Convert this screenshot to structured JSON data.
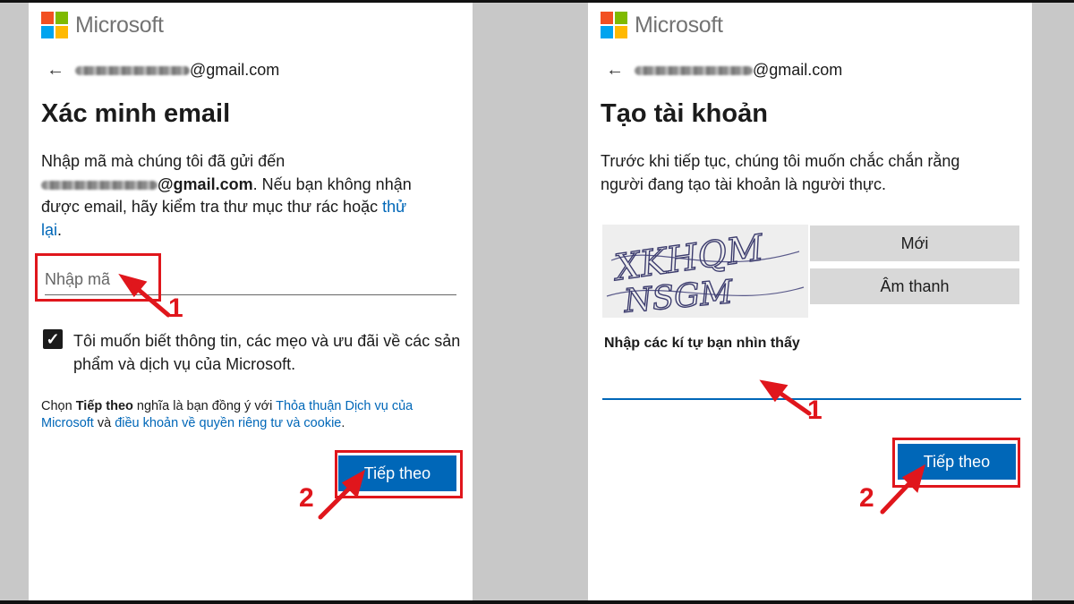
{
  "left_panel": {
    "brand": "Microsoft",
    "email_suffix": "@gmail.com",
    "title": "Xác minh email",
    "desc_line1": "Nhập mã mà chúng tôi đã gửi đến",
    "desc_email": "@gmail.com",
    "desc_line2_rest": ". Nếu bạn không nhận",
    "desc_line3": "được email, hãy kiểm tra thư mục thư rác hoặc ",
    "desc_link_a": "thử",
    "desc_link_b": "lại",
    "desc_end": ".",
    "code_placeholder": "Nhập mã",
    "checkbox_label": "Tôi muốn biết thông tin, các mẹo và ưu đãi về các sản phẩm và dịch vụ của Microsoft.",
    "checkbox_checked": true,
    "legal_prefix": "Chọn ",
    "legal_bold": "Tiếp theo",
    "legal_mid": " nghĩa là bạn đồng ý với ",
    "legal_link1": "Thỏa thuận Dịch vụ của Microsoft",
    "legal_and": " và ",
    "legal_link2": "điều khoản về quyền riêng tư và cookie",
    "legal_end": ".",
    "next_button": "Tiếp theo"
  },
  "right_panel": {
    "brand": "Microsoft",
    "email_suffix": "@gmail.com",
    "title": "Tạo tài khoản",
    "desc_line1": "Trước khi tiếp tục, chúng tôi muốn chắc chắn rằng",
    "desc_line2": "người đang tạo tài khoản là người thực.",
    "captcha_line1": "XKHQM",
    "captcha_line2": "NSGM",
    "new_button": "Mới",
    "audio_button": "Âm thanh",
    "field_label": "Nhập các kí tự bạn nhìn thấy",
    "next_button": "Tiếp theo"
  },
  "annotations": {
    "step1": "1",
    "step2": "2",
    "color": "#e0161c"
  },
  "colors": {
    "accent": "#0067b8",
    "background": "#c8c8c8"
  }
}
